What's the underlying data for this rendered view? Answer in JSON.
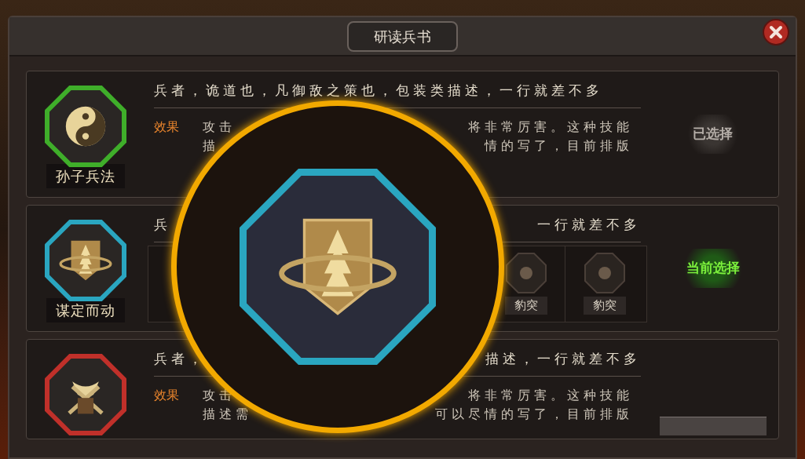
{
  "window": {
    "title": "研读兵书"
  },
  "books": [
    {
      "name": "孙子兵法",
      "color": "#3fae2a",
      "kind": "effect",
      "status": {
        "kind": "selected",
        "label": "已选择"
      },
      "title": [
        "兵者，诡道也，凡御敌之策也，包装类描述，一行就差不多"
      ],
      "effect_label": "效果",
      "effect_lines": [
        [
          "攻击",
          "将非常厉害。这种技能"
        ],
        [
          "描",
          "情的写了，目前排版"
        ]
      ]
    },
    {
      "name": "谋定而动",
      "color": "#2aa6c0",
      "kind": "tactics",
      "status": {
        "kind": "current",
        "label": "当前选择"
      },
      "title": [
        "兵",
        "一行就差不多"
      ],
      "tactics": [
        {
          "label": "豹突"
        },
        {
          "label": "豹突"
        }
      ]
    },
    {
      "color": "#c0302a",
      "kind": "effect",
      "title": [
        "兵者，",
        "描述，一行就差不多"
      ],
      "effect_label": "效果",
      "effect_lines": [
        [
          "攻击",
          "将非常厉害。这种技能"
        ],
        [
          "描述需",
          "可以尽情的写了，目前排版"
        ]
      ]
    }
  ]
}
